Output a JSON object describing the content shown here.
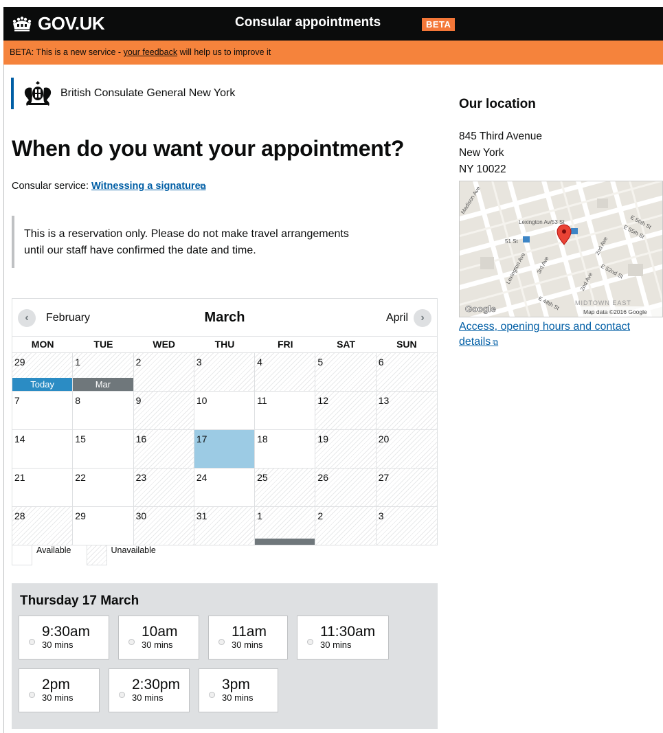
{
  "header": {
    "logo_text": "GOV.UK",
    "service_name": "Consular appointments",
    "beta_tag": "BETA"
  },
  "phase_banner": {
    "prefix": "BETA: This is a new service - ",
    "link": "your feedback",
    "suffix": " will help us to improve it"
  },
  "organisation": {
    "name": "British Consulate General New York"
  },
  "page": {
    "title": "When do you want your appointment?",
    "service_label": "Consular service: ",
    "service_link": "Witnessing a signature",
    "inset_line1": "This is a reservation only. Please do not make travel arrangements",
    "inset_line2": "until our staff have confirmed the date and time."
  },
  "calendar": {
    "prev_month": "February",
    "current_month": "March",
    "next_month": "April",
    "weekdays": [
      "MON",
      "TUE",
      "WED",
      "THU",
      "FRI",
      "SAT",
      "SUN"
    ],
    "days": [
      {
        "num": "29",
        "state": "unavailable",
        "label": "Today",
        "label_type": "today"
      },
      {
        "num": "1",
        "state": "unavailable",
        "label": "Mar",
        "label_type": "month"
      },
      {
        "num": "2",
        "state": "unavailable"
      },
      {
        "num": "3",
        "state": "unavailable"
      },
      {
        "num": "4",
        "state": "unavailable"
      },
      {
        "num": "5",
        "state": "unavailable"
      },
      {
        "num": "6",
        "state": "unavailable"
      },
      {
        "num": "7",
        "state": "available"
      },
      {
        "num": "8",
        "state": "available"
      },
      {
        "num": "9",
        "state": "unavailable"
      },
      {
        "num": "10",
        "state": "available"
      },
      {
        "num": "11",
        "state": "available"
      },
      {
        "num": "12",
        "state": "unavailable"
      },
      {
        "num": "13",
        "state": "unavailable"
      },
      {
        "num": "14",
        "state": "available"
      },
      {
        "num": "15",
        "state": "available"
      },
      {
        "num": "16",
        "state": "unavailable"
      },
      {
        "num": "17",
        "state": "selected"
      },
      {
        "num": "18",
        "state": "available"
      },
      {
        "num": "19",
        "state": "unavailable"
      },
      {
        "num": "20",
        "state": "unavailable"
      },
      {
        "num": "21",
        "state": "available"
      },
      {
        "num": "22",
        "state": "available"
      },
      {
        "num": "23",
        "state": "unavailable"
      },
      {
        "num": "24",
        "state": "available"
      },
      {
        "num": "25",
        "state": "unavailable"
      },
      {
        "num": "26",
        "state": "unavailable"
      },
      {
        "num": "27",
        "state": "unavailable"
      },
      {
        "num": "28",
        "state": "unavailable"
      },
      {
        "num": "29",
        "state": "available"
      },
      {
        "num": "30",
        "state": "unavailable"
      },
      {
        "num": "31",
        "state": "unavailable"
      },
      {
        "num": "1",
        "state": "unavailable",
        "label": "",
        "label_type": "month-cut"
      },
      {
        "num": "2",
        "state": "unavailable"
      },
      {
        "num": "3",
        "state": "unavailable"
      }
    ]
  },
  "legend": {
    "available": "Available",
    "unavailable": "Unavailable"
  },
  "times": {
    "title": "Thursday 17 March",
    "rows": [
      [
        {
          "time": "9:30am",
          "duration": "30 mins"
        },
        {
          "time": "10am",
          "duration": "30 mins"
        },
        {
          "time": "11am",
          "duration": "30 mins"
        },
        {
          "time": "11:30am",
          "duration": "30 mins"
        }
      ],
      [
        {
          "time": "2pm",
          "duration": "30 mins"
        },
        {
          "time": "2:30pm",
          "duration": "30 mins"
        },
        {
          "time": "3pm",
          "duration": "30 mins"
        }
      ]
    ]
  },
  "sidebar": {
    "title": "Our location",
    "address_line1": "845 Third Avenue",
    "address_line2": "New York",
    "address_line3": "NY 10022",
    "map": {
      "streets": [
        "Madison Ave",
        "Lexington Av/53 St",
        "51 St",
        "Lexington Ave",
        "3rd Ave",
        "2nd Ave",
        "2nd Ave",
        "E 56th St",
        "E 55th St",
        "E 52nd St",
        "E 48th St",
        "MIDTOWN EAST"
      ],
      "google_logo": "Google",
      "attribution": "Map data ©2016 Google"
    },
    "access_link": "Access, opening hours and contact details"
  },
  "colors": {
    "black": "#0b0c0c",
    "beta_orange": "#f47738",
    "banner_orange": "#f5833c",
    "link_blue": "#005ea5",
    "selected_blue": "#9ccbe4",
    "today_blue": "#2b8cc4",
    "grey": "#dee0e2"
  }
}
